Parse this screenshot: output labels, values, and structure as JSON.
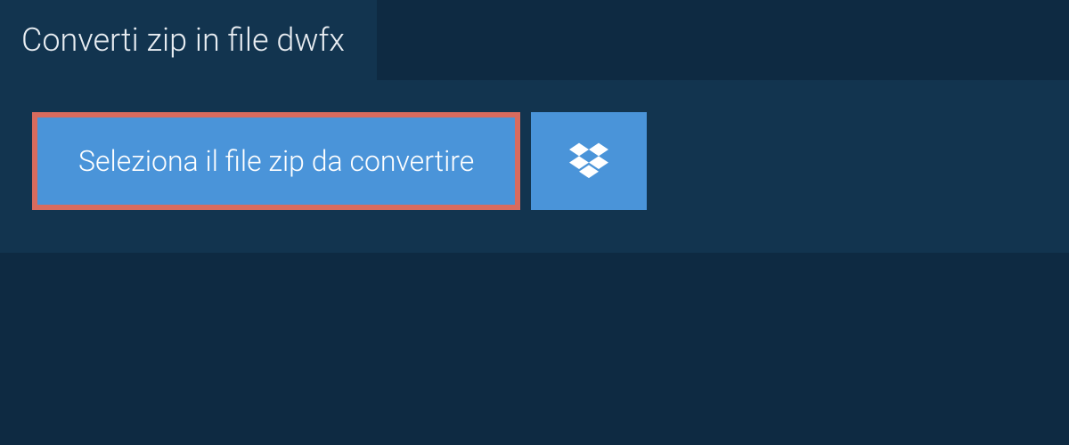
{
  "header": {
    "title": "Converti zip in file dwfx"
  },
  "upload": {
    "select_button_label": "Seleziona il file zip da convertire",
    "dropbox_icon": "dropbox-icon"
  },
  "colors": {
    "background": "#0e2a42",
    "panel": "#12344f",
    "button": "#4a94d9",
    "highlight_border": "#d86b5e",
    "text_light": "#e8edf2"
  }
}
